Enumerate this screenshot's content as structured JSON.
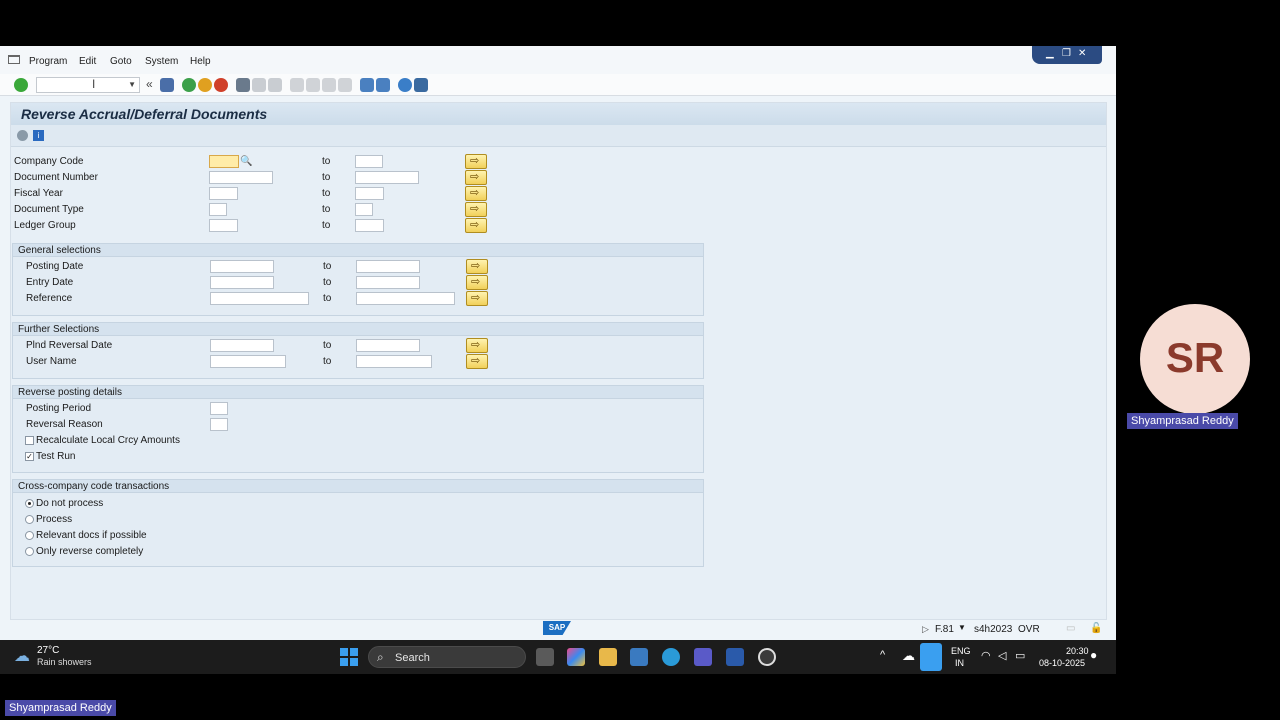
{
  "menu": {
    "items": [
      "Program",
      "Edit",
      "Goto",
      "System",
      "Help"
    ]
  },
  "page": {
    "title": "Reverse Accrual/Deferral Documents"
  },
  "selection": {
    "to_label": "to",
    "rows": [
      {
        "label": "Company Code"
      },
      {
        "label": "Document Number"
      },
      {
        "label": "Fiscal Year"
      },
      {
        "label": "Document Type"
      },
      {
        "label": "Ledger Group"
      }
    ]
  },
  "general": {
    "header": "General selections",
    "rows": [
      {
        "label": "Posting Date"
      },
      {
        "label": "Entry Date"
      },
      {
        "label": "Reference"
      }
    ]
  },
  "further": {
    "header": "Further Selections",
    "rows": [
      {
        "label": "Plnd Reversal Date"
      },
      {
        "label": "User Name"
      }
    ]
  },
  "reverse": {
    "header": "Reverse posting details",
    "posting_period": "Posting Period",
    "reversal_reason": "Reversal Reason",
    "recalc_label": "Recalculate Local Crcy Amounts",
    "recalc_checked": false,
    "testrun_label": "Test Run",
    "testrun_checked": true
  },
  "cross": {
    "header": "Cross-company code transactions",
    "options": [
      "Do not process",
      "Process",
      "Relevant docs if possible",
      "Only reverse completely"
    ],
    "selected": "Do not process"
  },
  "status": {
    "transaction": "F.81",
    "system": "s4h2023",
    "mode": "OVR",
    "sap_logo": "SAP"
  },
  "taskbar": {
    "temperature": "27°C",
    "weather": "Rain showers",
    "search_placeholder": "Search",
    "lang": "ENG",
    "region": "IN",
    "time": "20:30",
    "date": "08-10-2025"
  },
  "participant": {
    "initials": "SR",
    "name": "Shyamprasad Reddy"
  }
}
